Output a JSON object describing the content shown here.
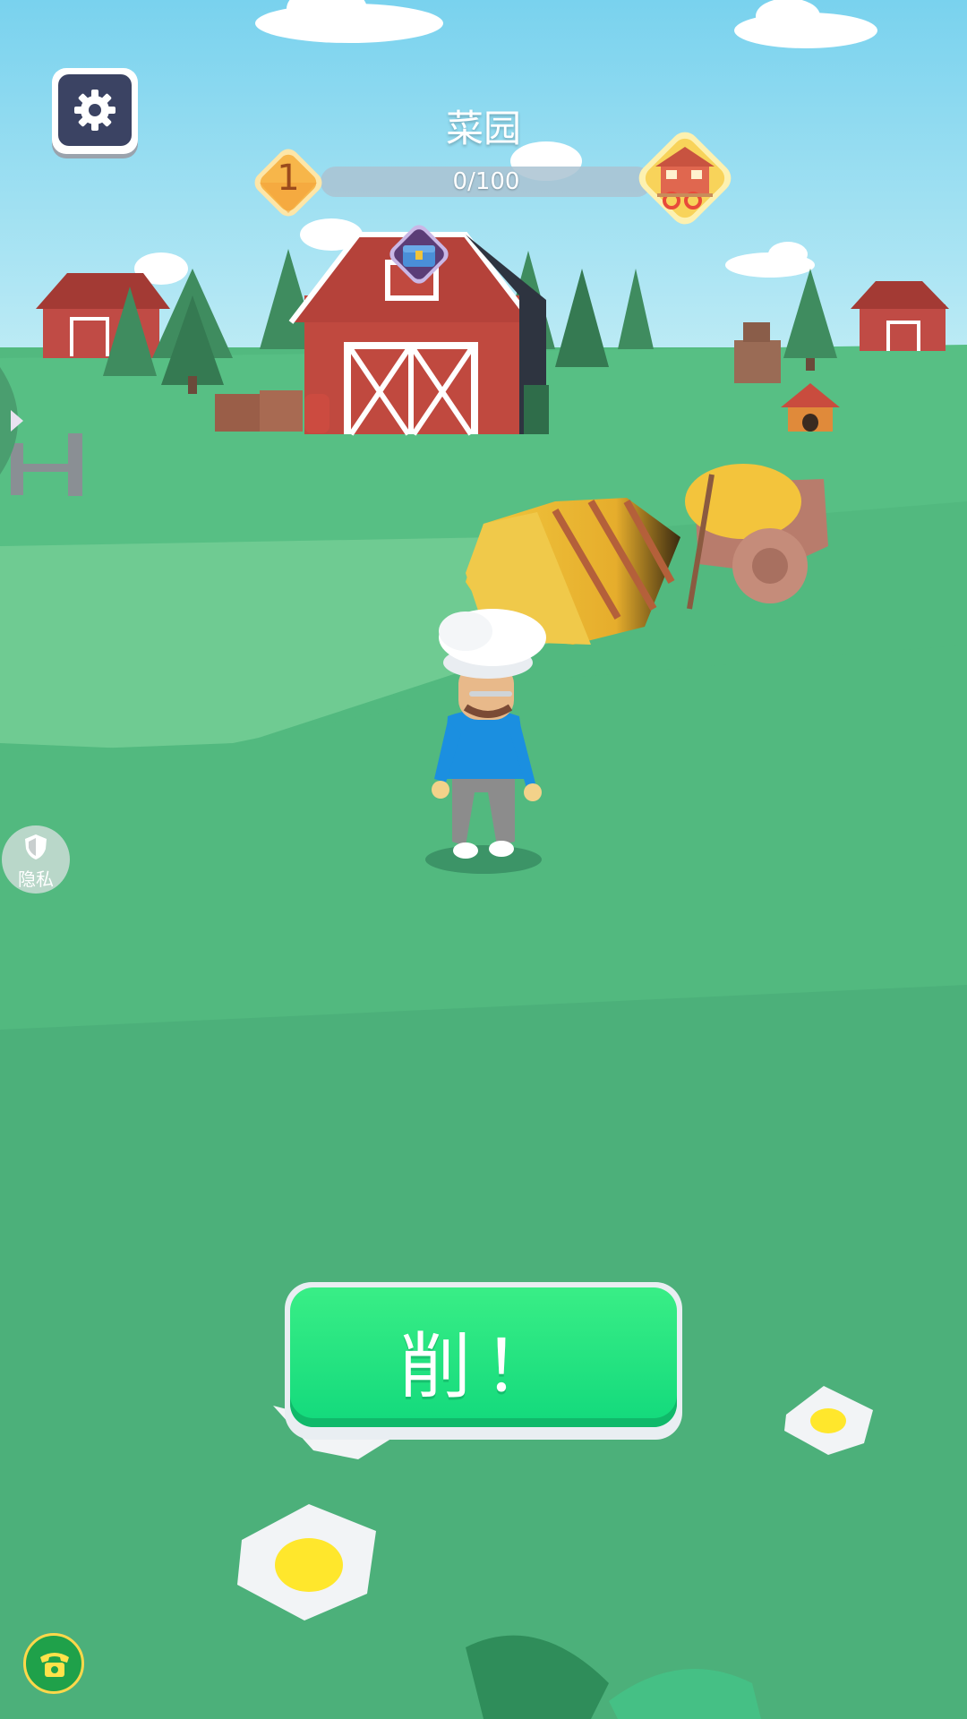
{
  "hud": {
    "level_name": "菜园",
    "current_level": "1",
    "progress_text": "0/100",
    "progress_value": 0,
    "progress_max": 100
  },
  "buttons": {
    "settings_icon": "gear-icon",
    "action_label": "削！",
    "privacy_label": "隐私",
    "privacy_icon": "shield-icon",
    "phone_icon": "telephone-icon"
  },
  "colors": {
    "sky": "#8fdcef",
    "grass": "#52b97f",
    "action_button": "#22e07f",
    "settings_button": "#3b4363",
    "level_badge": "#f7b64a"
  }
}
